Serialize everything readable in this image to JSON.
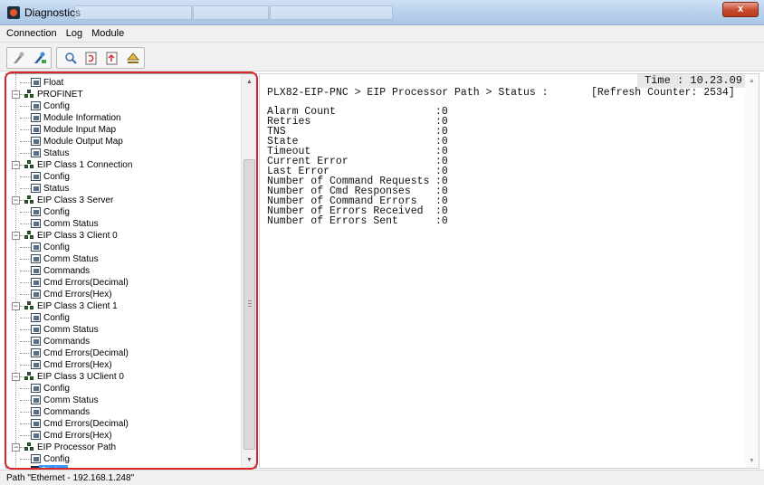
{
  "window": {
    "title": "Diagnostics",
    "close_label": "x"
  },
  "menu": [
    "Connection",
    "Log",
    "Module"
  ],
  "toolbar": {
    "buttons": [
      "disconnect-icon",
      "connect-icon",
      "search-icon",
      "refresh-icon",
      "upload-icon",
      "eject-icon"
    ]
  },
  "tree": {
    "items": [
      {
        "label": "Float",
        "level": 2,
        "type": "leaf"
      },
      {
        "label": "PROFINET",
        "level": 1,
        "type": "group"
      },
      {
        "label": "Config",
        "level": 2,
        "type": "leaf"
      },
      {
        "label": "Module Information",
        "level": 2,
        "type": "leaf"
      },
      {
        "label": "Module Input Map",
        "level": 2,
        "type": "leaf"
      },
      {
        "label": "Module Output Map",
        "level": 2,
        "type": "leaf"
      },
      {
        "label": "Status",
        "level": 2,
        "type": "leaf"
      },
      {
        "label": "EIP Class 1 Connection",
        "level": 1,
        "type": "group"
      },
      {
        "label": "Config",
        "level": 2,
        "type": "leaf"
      },
      {
        "label": "Status",
        "level": 2,
        "type": "leaf"
      },
      {
        "label": "EIP Class 3 Server",
        "level": 1,
        "type": "group"
      },
      {
        "label": "Config",
        "level": 2,
        "type": "leaf"
      },
      {
        "label": "Comm Status",
        "level": 2,
        "type": "leaf"
      },
      {
        "label": "EIP Class 3 Client 0",
        "level": 1,
        "type": "group"
      },
      {
        "label": "Config",
        "level": 2,
        "type": "leaf"
      },
      {
        "label": "Comm Status",
        "level": 2,
        "type": "leaf"
      },
      {
        "label": "Commands",
        "level": 2,
        "type": "leaf"
      },
      {
        "label": "Cmd Errors(Decimal)",
        "level": 2,
        "type": "leaf"
      },
      {
        "label": "Cmd Errors(Hex)",
        "level": 2,
        "type": "leaf"
      },
      {
        "label": "EIP Class 3 Client 1",
        "level": 1,
        "type": "group"
      },
      {
        "label": "Config",
        "level": 2,
        "type": "leaf"
      },
      {
        "label": "Comm Status",
        "level": 2,
        "type": "leaf"
      },
      {
        "label": "Commands",
        "level": 2,
        "type": "leaf"
      },
      {
        "label": "Cmd Errors(Decimal)",
        "level": 2,
        "type": "leaf"
      },
      {
        "label": "Cmd Errors(Hex)",
        "level": 2,
        "type": "leaf"
      },
      {
        "label": "EIP Class 3 UClient 0",
        "level": 1,
        "type": "group"
      },
      {
        "label": "Config",
        "level": 2,
        "type": "leaf"
      },
      {
        "label": "Comm Status",
        "level": 2,
        "type": "leaf"
      },
      {
        "label": "Commands",
        "level": 2,
        "type": "leaf"
      },
      {
        "label": "Cmd Errors(Decimal)",
        "level": 2,
        "type": "leaf"
      },
      {
        "label": "Cmd Errors(Hex)",
        "level": 2,
        "type": "leaf"
      },
      {
        "label": "EIP Processor Path",
        "level": 1,
        "type": "group"
      },
      {
        "label": "Config",
        "level": 2,
        "type": "leaf"
      },
      {
        "label": "Status",
        "level": 2,
        "type": "leaf",
        "selected": true
      }
    ]
  },
  "content": {
    "time": "Time : 10.23.09",
    "path": "PLX82-EIP-PNC > EIP Processor Path > Status :",
    "refresh_counter": "[Refresh Counter: 2534]",
    "status_rows": [
      {
        "key": "Alarm Count",
        "value": ":0"
      },
      {
        "key": "Retries",
        "value": ":0"
      },
      {
        "key": "TNS",
        "value": ":0"
      },
      {
        "key": "State",
        "value": ":0"
      },
      {
        "key": "Timeout",
        "value": ":0"
      },
      {
        "key": "Current Error",
        "value": ":0"
      },
      {
        "key": "Last Error",
        "value": ":0"
      },
      {
        "key": "Number of Command Requests",
        "value": ":0"
      },
      {
        "key": "Number of Cmd Responses",
        "value": ":0"
      },
      {
        "key": "Number of Command Errors",
        "value": ":0"
      },
      {
        "key": "Number of Errors Received",
        "value": ":0"
      },
      {
        "key": "Number of Errors Sent",
        "value": ":0"
      }
    ]
  },
  "statusbar": {
    "path": "Path \"Ethernet - 192.168.1.248\""
  },
  "colors": {
    "highlight": "#d9262a",
    "selection": "#3399ff"
  }
}
